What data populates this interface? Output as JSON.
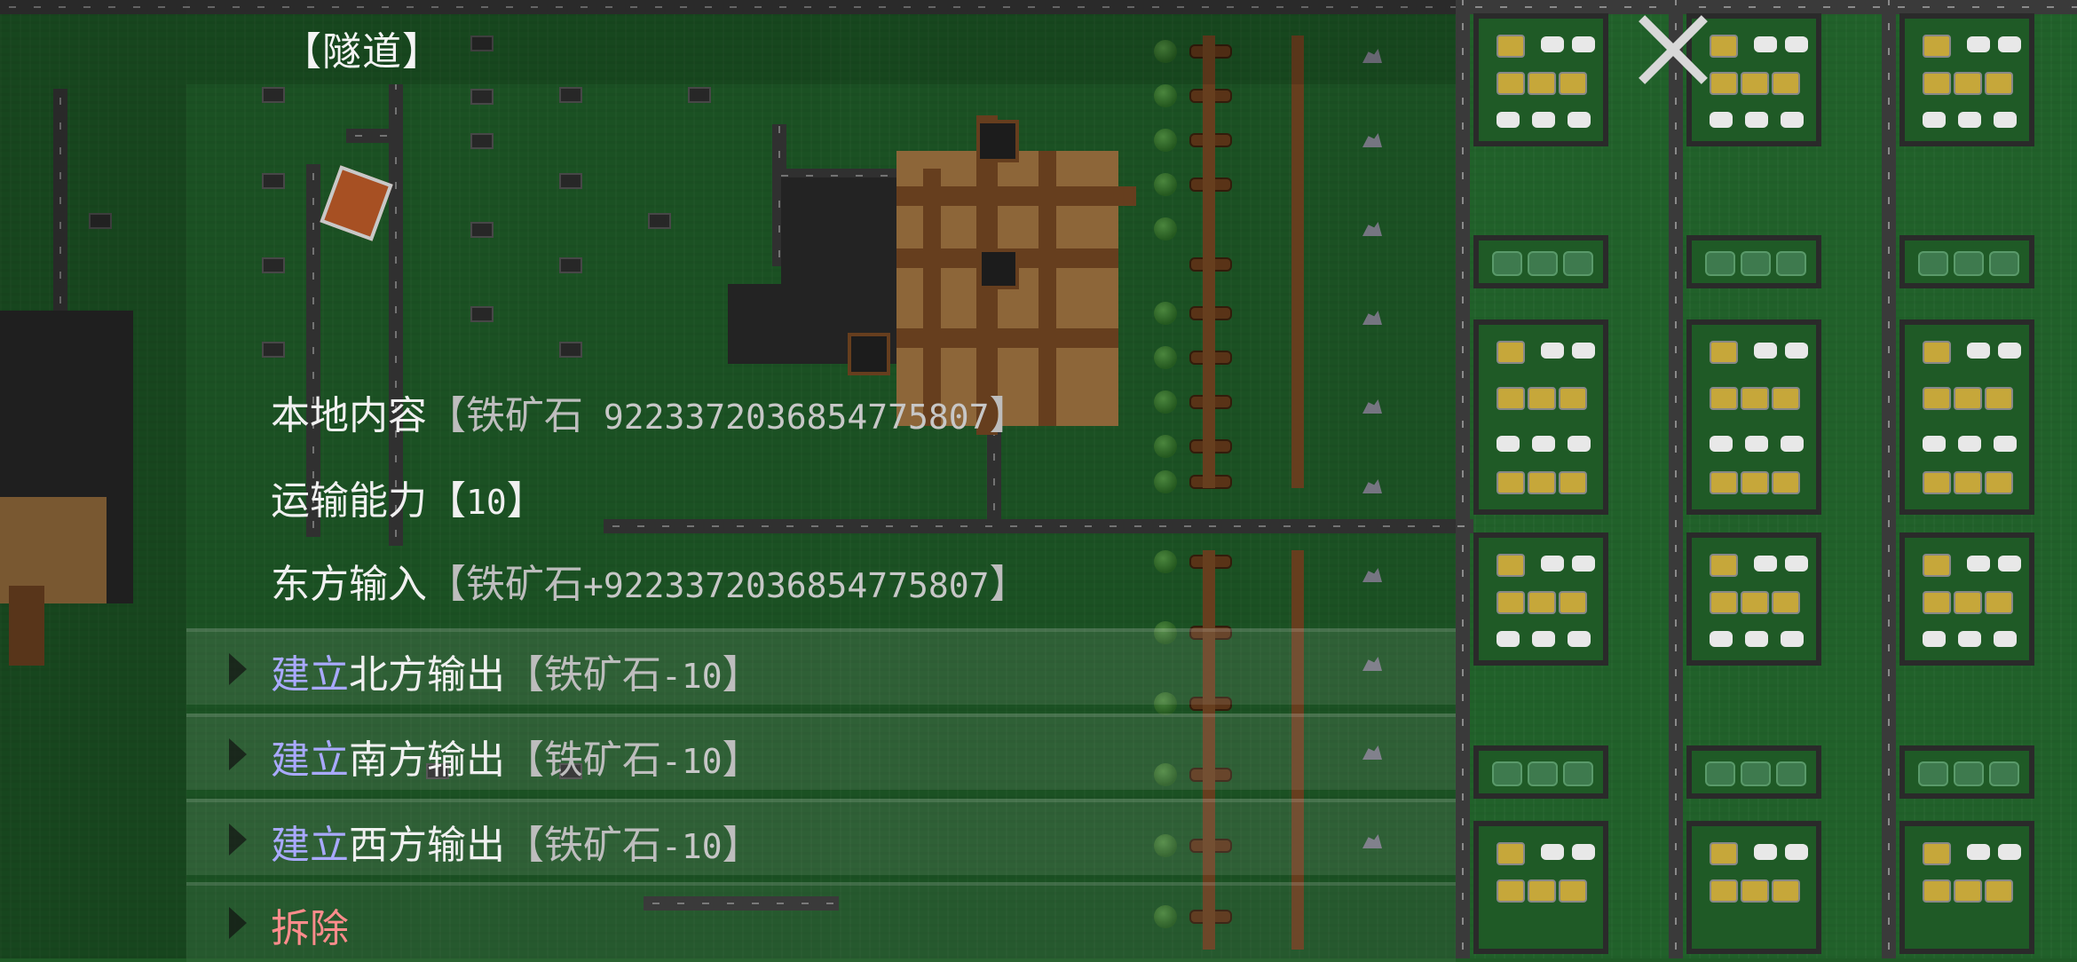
{
  "dialog": {
    "title": "【隧道】",
    "close_label": "",
    "local_content": {
      "label": "本地内容",
      "open": "【",
      "item": "铁矿石",
      "value": " 9223372036854775807",
      "close": "】"
    },
    "transport_capacity": {
      "label": "运输能力",
      "open": "【",
      "value": "10",
      "close": "】"
    },
    "east_input": {
      "label": "东方输入",
      "open": "【",
      "item": "铁矿石",
      "value": "+9223372036854775807",
      "close": "】"
    },
    "actions": [
      {
        "verb": "建立",
        "target": "北方输出",
        "open": "【",
        "item": "铁矿石",
        "value": "-10",
        "close": "】"
      },
      {
        "verb": "建立",
        "target": "南方输出",
        "open": "【",
        "item": "铁矿石",
        "value": "-10",
        "close": "】"
      },
      {
        "verb": "建立",
        "target": "西方输出",
        "open": "【",
        "item": "铁矿石",
        "value": "-10",
        "close": "】"
      }
    ],
    "demolish": {
      "verb": "拆除"
    }
  },
  "colors": {
    "grass": "#21612a",
    "action_verb": "#a9a9ff",
    "demolish_verb": "#ff8c8c",
    "text": "#f0f0f0",
    "bracket_text": "#c7c7c7"
  },
  "icons": [
    "close-icon",
    "expand-triangle-icon"
  ]
}
